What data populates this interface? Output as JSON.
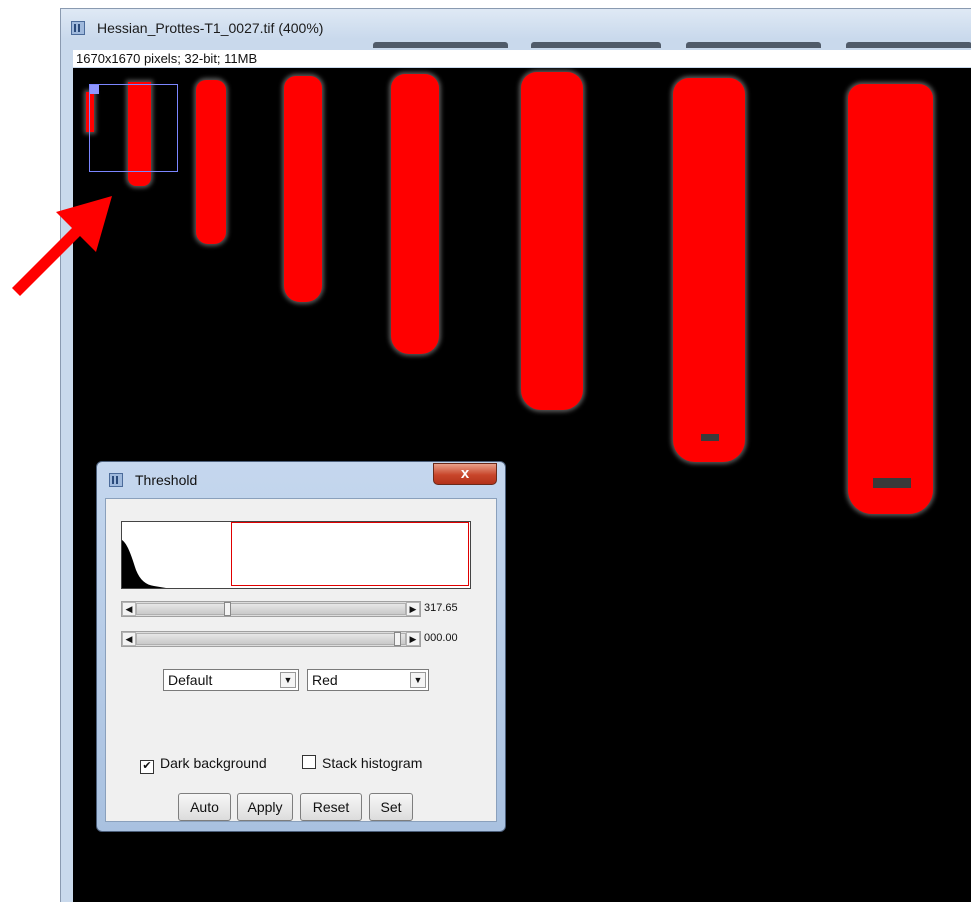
{
  "window": {
    "title": "Hessian_Prottes-T1_0027.tif (400%)",
    "image_info": "1670x1670 pixels; 32-bit; 11MB",
    "icon": "imagej-icon"
  },
  "canvas": {
    "background_color": "#000000",
    "mask_color": "#ff0000",
    "selection_color": "#7b86ff",
    "annotation_arrow_color": "#ff0000"
  },
  "threshold_dialog": {
    "title": "Threshold",
    "close_label": "x",
    "histogram": {
      "threshold_box_color": "#e00000"
    },
    "slider_lower": {
      "value": "317.65"
    },
    "slider_upper": {
      "value": "000.00"
    },
    "method_select": {
      "selected": "Default"
    },
    "display_select": {
      "selected": "Red"
    },
    "dark_background": {
      "label": "Dark background",
      "checked": true
    },
    "stack_histogram": {
      "label": "Stack histogram",
      "checked": false
    },
    "buttons": {
      "auto": "Auto",
      "apply": "Apply",
      "reset": "Reset",
      "set": "Set"
    }
  }
}
